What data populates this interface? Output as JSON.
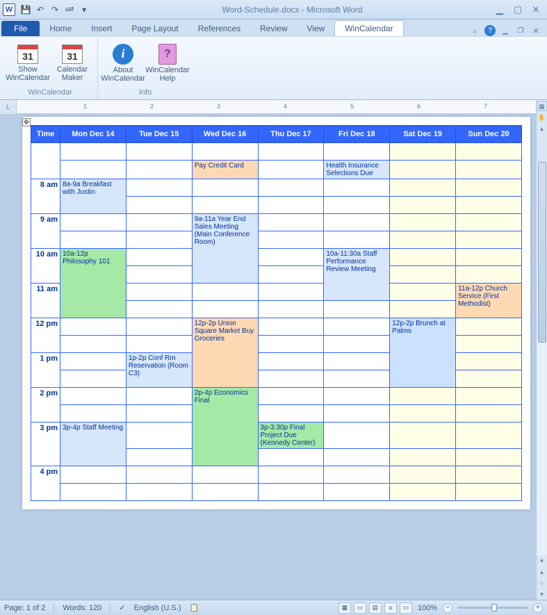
{
  "app": {
    "title": "Word-Schedule.docx  -  Microsoft Word"
  },
  "qat": {
    "save": "💾",
    "undo": "↶",
    "redo": "↷",
    "lang": "a⇄"
  },
  "tabs": {
    "file": "File",
    "home": "Home",
    "insert": "Insert",
    "page_layout": "Page Layout",
    "references": "References",
    "review": "Review",
    "view": "View",
    "wincalendar": "WinCalendar"
  },
  "ribbon": {
    "group1": {
      "btn1": "Show WinCalendar",
      "btn2": "Calendar Maker",
      "label": "WinCalendar"
    },
    "group2": {
      "btn1": "About WinCalendar",
      "btn2": "WinCalendar Help",
      "label": "Info"
    },
    "cal_num": "31"
  },
  "ruler": {
    "n1": "1",
    "n2": "2",
    "n3": "3",
    "n4": "4",
    "n5": "5",
    "n6": "6",
    "n7": "7"
  },
  "calendar": {
    "headers": {
      "time": "Time",
      "d1": "Mon Dec 14",
      "d2": "Tue Dec 15",
      "d3": "Wed Dec 16",
      "d4": "Thu Dec 17",
      "d5": "Fri Dec 18",
      "d6": "Sat Dec 19",
      "d7": "Sun Dec 20"
    },
    "times": {
      "t8": "8 am",
      "t9": "9 am",
      "t10": "10 am",
      "t11": "11 am",
      "t12": "12 pm",
      "t1": "1 pm",
      "t2": "2 pm",
      "t3": "3 pm",
      "t4": "4 pm"
    },
    "events": {
      "pay_credit": "Pay Credit Card",
      "health_ins": "Health Insurance Selections Due",
      "breakfast": "8a-9a Breakfast with Justin",
      "sales_mtg": "9a-11a Year End Sales Meeting (Main Conference Room)",
      "philosophy": "10a-12p Philosophy 101",
      "staff_perf": "10a-11:30a Staff Performance Review Meeting",
      "church": "11a-12p Church Service (First Methodist)",
      "market": "12p-2p Union Square Market Buy Groceries",
      "brunch": "12p-2p Brunch at Palms",
      "conf_rm": "1p-2p Conf Rm Reservation (Room C3)",
      "econ_final": "2p-4p Economics Final",
      "final_proj": "3p-3:30p Final Project Due (Kennedy Center)",
      "staff_mtg": "3p-4p Staff Meeting"
    }
  },
  "status": {
    "page": "Page: 1 of 2",
    "words": "Words: 120",
    "lang": "English (U.S.)",
    "zoom": "100%"
  }
}
